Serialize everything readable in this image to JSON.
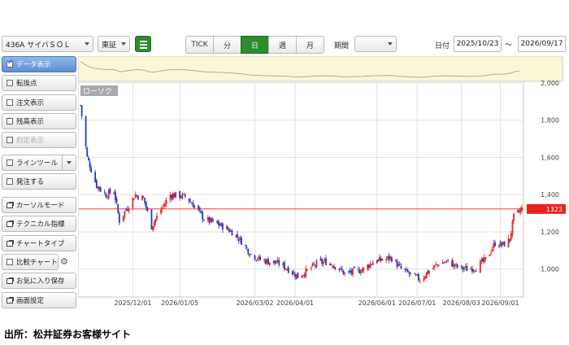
{
  "toolbar": {
    "symbol": "436A サイバＳＯＬ",
    "market": "東証",
    "intervals": [
      "TICK",
      "分",
      "日",
      "週",
      "月"
    ],
    "active_interval": "日",
    "period_label": "期間",
    "period_value": "",
    "date_label": "日付",
    "date_from": "2025/10/23",
    "tilde": "～",
    "date_to": "2026/09/17"
  },
  "sidebar": {
    "items": [
      {
        "label": "データ表示",
        "type": "check",
        "checked": true
      },
      {
        "label": "転換点",
        "type": "check"
      },
      {
        "label": "注文表示",
        "type": "check"
      },
      {
        "label": "残高表示",
        "type": "check"
      },
      {
        "label": "約定表示",
        "type": "check",
        "disabled": true
      },
      {
        "label": "ラインツール",
        "type": "check",
        "dropdown": true
      },
      {
        "label": "発注する",
        "type": "check"
      },
      {
        "label": "カーソルモード",
        "type": "window"
      },
      {
        "label": "テクニカル指標",
        "type": "window"
      },
      {
        "label": "チャートタイプ",
        "type": "window"
      },
      {
        "label": "比較チャート",
        "type": "check",
        "gear": true
      },
      {
        "label": "お気に入り保存",
        "type": "window"
      },
      {
        "label": "画面設定",
        "type": "window"
      }
    ]
  },
  "chart_data": {
    "type": "candlestick",
    "series_label": "ローソク",
    "ylim": [
      850,
      2000
    ],
    "yticks": [
      "2,000",
      "1,800",
      "1,600",
      "1,400",
      "1,200",
      "1,000"
    ],
    "ytick_values": [
      2000,
      1800,
      1600,
      1400,
      1200,
      1000
    ],
    "xtick_labels": [
      "2025/12/01",
      "2026/01/05",
      "2026/03/02",
      "2026/04/01",
      "2026/06/01",
      "2026/07/01",
      "2026/08/03",
      "2026/09/01"
    ],
    "price_line": 1323,
    "price_label": "1323",
    "close_path": [
      [
        "2025-10-23",
        1880
      ],
      [
        "2025-10-28",
        1600
      ],
      [
        "2025-11-04",
        1450
      ],
      [
        "2025-11-11",
        1400
      ],
      [
        "2025-11-17",
        1420
      ],
      [
        "2025-11-21",
        1260
      ],
      [
        "2025-11-26",
        1320
      ],
      [
        "2025-12-03",
        1400
      ],
      [
        "2025-12-09",
        1380
      ],
      [
        "2025-12-15",
        1230
      ],
      [
        "2025-12-22",
        1320
      ],
      [
        "2025-12-29",
        1400
      ],
      [
        "2026-01-09",
        1390
      ],
      [
        "2026-01-16",
        1340
      ],
      [
        "2026-01-23",
        1270
      ],
      [
        "2026-01-30",
        1250
      ],
      [
        "2026-02-06",
        1230
      ],
      [
        "2026-02-13",
        1200
      ],
      [
        "2026-02-20",
        1150
      ],
      [
        "2026-02-27",
        1080
      ],
      [
        "2026-03-06",
        1050
      ],
      [
        "2026-03-13",
        1040
      ],
      [
        "2026-03-20",
        1030
      ],
      [
        "2026-03-27",
        1000
      ],
      [
        "2026-04-03",
        960
      ],
      [
        "2026-04-10",
        990
      ],
      [
        "2026-04-17",
        1030
      ],
      [
        "2026-04-24",
        1040
      ],
      [
        "2026-05-01",
        1020
      ],
      [
        "2026-05-08",
        975
      ],
      [
        "2026-05-15",
        985
      ],
      [
        "2026-05-22",
        1000
      ],
      [
        "2026-05-29",
        1040
      ],
      [
        "2026-06-05",
        1050
      ],
      [
        "2026-06-12",
        1060
      ],
      [
        "2026-06-19",
        1000
      ],
      [
        "2026-06-26",
        970
      ],
      [
        "2026-07-03",
        945
      ],
      [
        "2026-07-10",
        990
      ],
      [
        "2026-07-17",
        1030
      ],
      [
        "2026-07-24",
        1040
      ],
      [
        "2026-07-31",
        1010
      ],
      [
        "2026-08-07",
        1000
      ],
      [
        "2026-08-14",
        1010
      ],
      [
        "2026-08-21",
        1050
      ],
      [
        "2026-08-28",
        1140
      ],
      [
        "2026-09-03",
        1130
      ],
      [
        "2026-09-08",
        1160
      ],
      [
        "2026-09-11",
        1280
      ],
      [
        "2026-09-17",
        1323
      ]
    ]
  },
  "source": "出所：松井証券お客様サイト"
}
